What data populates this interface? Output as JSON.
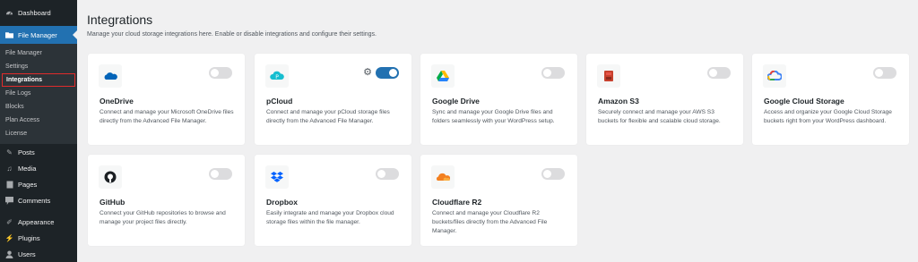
{
  "sidebar": {
    "dashboard": "Dashboard",
    "active": "File Manager",
    "submenu": [
      "File Manager",
      "Settings",
      "Integrations",
      "File Logs",
      "Blocks",
      "Plan Access",
      "License"
    ],
    "items": [
      "Posts",
      "Media",
      "Pages",
      "Comments",
      "Appearance",
      "Plugins",
      "Users"
    ]
  },
  "page": {
    "title": "Integrations",
    "description": "Manage your cloud storage integrations here. Enable or disable integrations and configure their settings."
  },
  "cards": [
    {
      "title": "OneDrive",
      "text": "Connect and manage your Microsoft OneDrive files directly from the Advanced File Manager.",
      "enabled": false,
      "logo": "onedrive-logo"
    },
    {
      "title": "pCloud",
      "text": "Connect and manage your pCloud storage files directly from the Advanced File Manager.",
      "enabled": true,
      "logo": "pcloud-logo"
    },
    {
      "title": "Google Drive",
      "text": "Sync and manage your Google Drive files and folders seamlessly with your WordPress setup.",
      "enabled": false,
      "logo": "google-drive-logo"
    },
    {
      "title": "Amazon S3",
      "text": "Securely connect and manage your AWS S3 buckets for flexible and scalable cloud storage.",
      "enabled": false,
      "logo": "amazon-s3-logo"
    },
    {
      "title": "Google Cloud Storage",
      "text": "Access and organize your Google Cloud Storage buckets right from your WordPress dashboard.",
      "enabled": false,
      "logo": "google-cloud-logo"
    },
    {
      "title": "GitHub",
      "text": "Connect your GitHub repositories to browse and manage your project files directly.",
      "enabled": false,
      "logo": "github-logo"
    },
    {
      "title": "Dropbox",
      "text": "Easily integrate and manage your Dropbox cloud storage files within the file manager.",
      "enabled": false,
      "logo": "dropbox-logo"
    },
    {
      "title": "Cloudflare R2",
      "text": "Connect and manage your Cloudflare R2 buckets/files directly from the Advanced File Manager.",
      "enabled": false,
      "logo": "cloudflare-r2-logo"
    }
  ]
}
